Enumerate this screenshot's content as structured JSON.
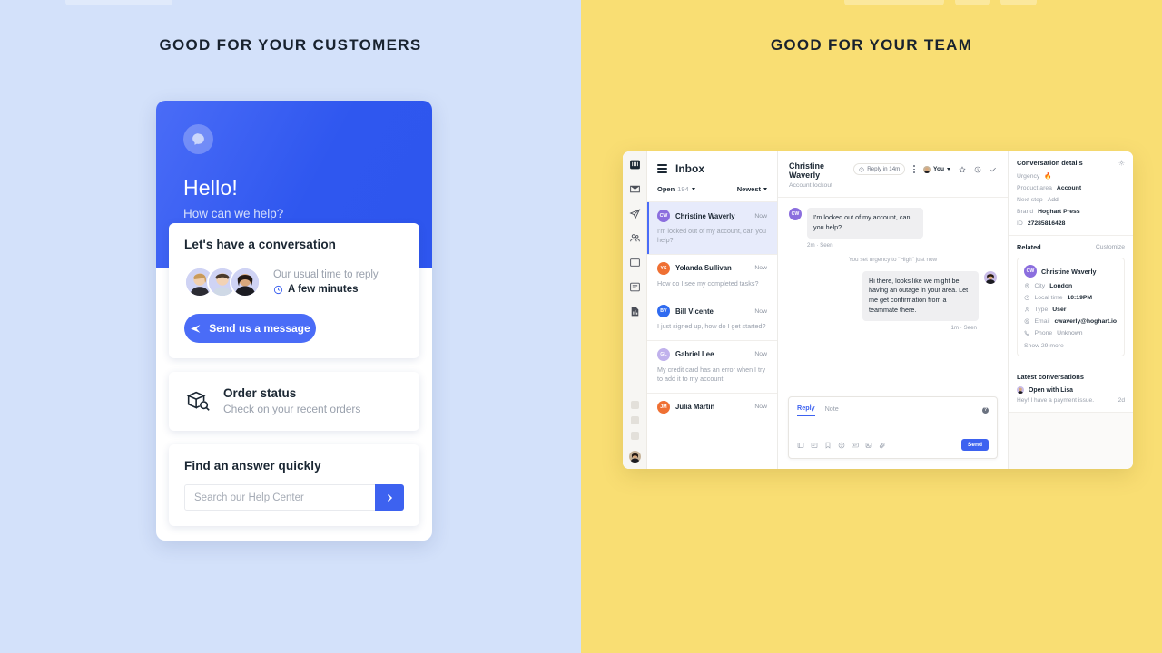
{
  "panels": {
    "left_heading": "GOOD FOR YOUR CUSTOMERS",
    "right_heading": "GOOD FOR YOUR TEAM",
    "left_bg": "#d3e1fa",
    "right_bg": "#f9de73"
  },
  "messenger": {
    "greeting": "Hello!",
    "subgreeting": "How can we help?",
    "conversation_card": {
      "title": "Let's have a conversation",
      "reply_label": "Our usual time to reply",
      "reply_value": "A few minutes",
      "clock_icon": "clock-icon",
      "button_label": "Send us a message",
      "button_icon": "paper-plane-icon"
    },
    "order_card": {
      "title": "Order status",
      "subtitle": "Check on your recent orders",
      "icon": "package-search-icon"
    },
    "search_card": {
      "title": "Find an answer quickly",
      "placeholder": "Search our Help Center",
      "value": "",
      "submit_icon": "chevron-right-icon"
    },
    "accent": "#3d62f0"
  },
  "app": {
    "rail": {
      "items": [
        {
          "name": "logo-icon"
        },
        {
          "name": "inbox-icon"
        },
        {
          "name": "paper-plane-icon"
        },
        {
          "name": "people-icon"
        },
        {
          "name": "book-icon"
        },
        {
          "name": "article-icon"
        },
        {
          "name": "report-icon"
        }
      ],
      "placeholders": 3,
      "avatar": "user-avatar"
    },
    "list": {
      "title": "Inbox",
      "menu_icon": "hamburger-icon",
      "filter_status": "Open",
      "filter_count": "194",
      "sort": "Newest",
      "conversations": [
        {
          "initials": "CW",
          "color": "#8b6ede",
          "name": "Christine Waverly",
          "time": "Now",
          "preview": "I'm locked out of my account, can you help?",
          "active": true
        },
        {
          "initials": "YS",
          "color": "#ef7033",
          "name": "Yolanda Sullivan",
          "time": "Now",
          "preview": "How do I see my completed tasks?",
          "active": false
        },
        {
          "initials": "BV",
          "color": "#2f6bf0",
          "name": "Bill Vicente",
          "time": "Now",
          "preview": "I just signed up, how do I get started?",
          "active": false
        },
        {
          "initials": "GL",
          "color": "#c0b1ec",
          "name": "Gabriel Lee",
          "time": "Now",
          "preview": "My credit card has an error when I try to add it to my account.",
          "active": false
        },
        {
          "initials": "JM",
          "color": "#ef7033",
          "name": "Julia Martin",
          "time": "Now",
          "preview": "",
          "active": false
        }
      ]
    },
    "thread": {
      "title": "Christine Waverly",
      "subtitle": "Account lockout",
      "sla_pill": "Reply in 14m",
      "sla_icon": "clock-icon",
      "more_icon": "kebab-menu-icon",
      "assignee": "You",
      "assignee_caret": "chevron-down-icon",
      "star_icon": "star-icon",
      "snooze_icon": "clock-icon",
      "close_icon": "checkmark-icon",
      "messages": [
        {
          "type": "in",
          "text": "I'm locked out of my account, can you help?",
          "meta": "2m · Seen",
          "avatar_initials": "CW",
          "avatar_color": "#8b6ede"
        },
        {
          "type": "event",
          "text": "You set urgency to \"High\" just now"
        },
        {
          "type": "out",
          "text": "Hi there, looks like we might be having an outage in your area. Let me get confirmation from a teammate there.",
          "meta": "1m · Seen"
        }
      ],
      "composer": {
        "tab_reply": "Reply",
        "tab_note": "Note",
        "help_icon": "help-icon",
        "value": "",
        "tools": [
          "saved-reply-icon",
          "article-icon",
          "bookmark-icon",
          "emoji-icon",
          "gif-icon",
          "image-icon",
          "attachment-icon"
        ],
        "send_label": "Send"
      }
    },
    "details": {
      "title": "Conversation details",
      "settings_icon": "gear-icon",
      "attributes": [
        {
          "key": "Urgency",
          "value": "🔥",
          "is_emoji": true
        },
        {
          "key": "Product area",
          "value": "Account"
        },
        {
          "key": "Next step",
          "value": "Add",
          "muted": true
        },
        {
          "key": "Brand",
          "value": "Hoghart Press"
        },
        {
          "key": "ID",
          "value": "27285816428"
        }
      ],
      "related_title": "Related",
      "related_action": "Customize",
      "person": {
        "initials": "CW",
        "color": "#8b6ede",
        "name": "Christine Waverly",
        "fields": [
          {
            "icon": "location-icon",
            "key": "City",
            "value": "London"
          },
          {
            "icon": "clock-icon",
            "key": "Local time",
            "value": "10:19PM"
          },
          {
            "icon": "person-icon",
            "key": "Type",
            "value": "User"
          },
          {
            "icon": "email-icon",
            "key": "Email",
            "value": "cwaverly@hoghart.io"
          },
          {
            "icon": "phone-icon",
            "key": "Phone",
            "value": "Unknown",
            "muted": true
          }
        ],
        "show_more": "Show 29 more"
      },
      "latest_title": "Latest conversations",
      "latest": [
        {
          "title": "Open with Lisa",
          "preview": "Hey! I have a payment issue.",
          "time": "2d"
        }
      ]
    }
  }
}
